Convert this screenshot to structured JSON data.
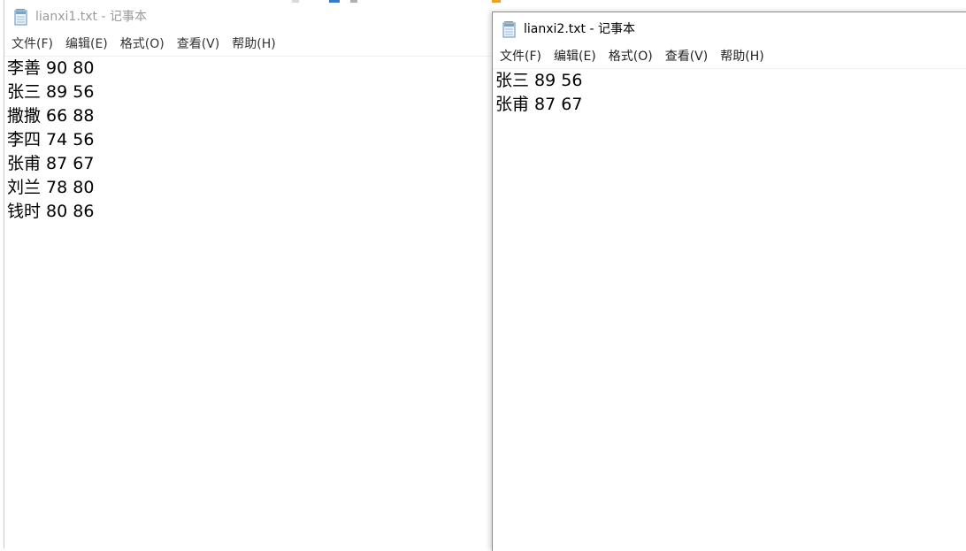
{
  "window1": {
    "title": "lianxi1.txt - 记事本",
    "menu": [
      "文件(F)",
      "编辑(E)",
      "格式(O)",
      "查看(V)",
      "帮助(H)"
    ],
    "lines": [
      "李善 90 80",
      "张三 89 56",
      "撒撒 66 88",
      "李四 74 56",
      "张甫 87 67",
      "刘兰 78 80",
      "钱时 80 86"
    ]
  },
  "window2": {
    "title": "lianxi2.txt - 记事本",
    "menu": [
      "文件(F)",
      "编辑(E)",
      "格式(O)",
      "查看(V)",
      "帮助(H)"
    ],
    "lines": [
      "张三 89 56",
      "张甫 87 67"
    ]
  },
  "colors": {
    "inactive_title": "#9a9a9a",
    "active_title": "#000000",
    "notepad_icon_blue": "#6aa6d8"
  },
  "icons": {
    "app": "notepad-icon"
  }
}
